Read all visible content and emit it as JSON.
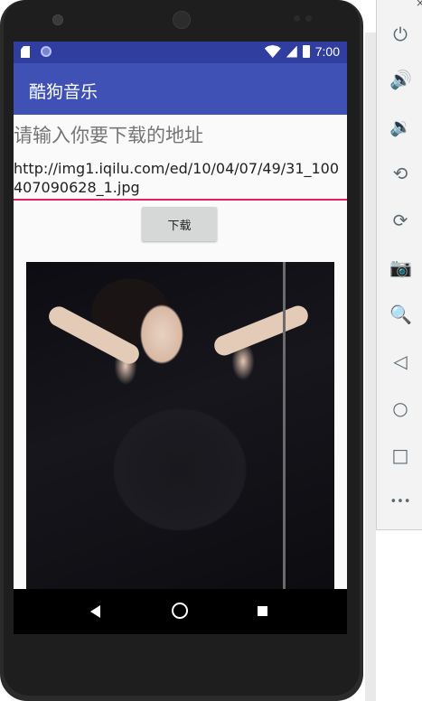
{
  "status_bar": {
    "time": "7:00"
  },
  "app_bar": {
    "title": "酷狗音乐"
  },
  "form": {
    "prompt": "请输入你要下载的地址",
    "url_value": "http://img1.iqilu.com/ed/10/04/07/49/31_100407090628_1.jpg",
    "download_label": "下载"
  },
  "emulator_toolbar": {
    "close_glyph": "×",
    "buttons": [
      {
        "icon": "power-icon",
        "glyph": "⏻"
      },
      {
        "icon": "volume-up-icon",
        "glyph": "🔊"
      },
      {
        "icon": "volume-down-icon",
        "glyph": "🔉"
      },
      {
        "icon": "rotate-left-icon",
        "glyph": "⟲"
      },
      {
        "icon": "rotate-right-icon",
        "glyph": "⟳"
      },
      {
        "icon": "camera-icon",
        "glyph": "📷"
      },
      {
        "icon": "zoom-icon",
        "glyph": "🔍"
      },
      {
        "icon": "back-icon",
        "glyph": "◁"
      },
      {
        "icon": "home-icon",
        "glyph": "○"
      },
      {
        "icon": "overview-icon",
        "glyph": "□"
      },
      {
        "icon": "more-icon",
        "glyph": "•••"
      }
    ]
  },
  "colors": {
    "status_bar": "#303f9f",
    "app_bar": "#3f51b5",
    "accent_underline": "#e91e63"
  }
}
